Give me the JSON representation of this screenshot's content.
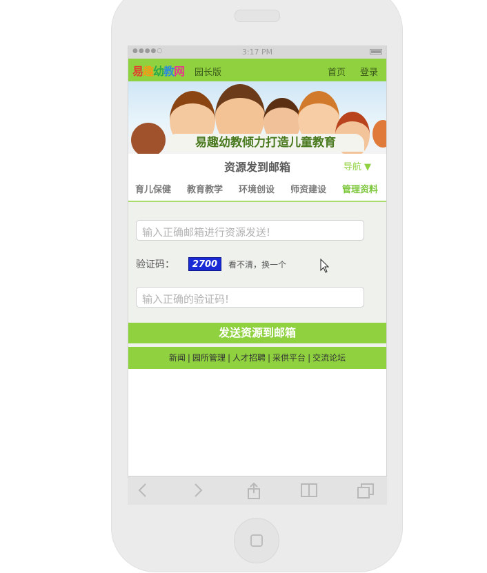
{
  "status_bar": {
    "signal": "●●●●○",
    "time": "3:17 PM"
  },
  "header": {
    "logo_chars": [
      "易",
      "趣",
      "幼",
      "教",
      "网"
    ],
    "version_label": "园长版",
    "nav": [
      {
        "label": "首页"
      },
      {
        "label": "登录"
      }
    ]
  },
  "banner": {
    "slogan": "易趣幼教倾力打造儿童教育"
  },
  "page": {
    "title": "资源发到邮箱",
    "nav_toggle": "导航 ▼"
  },
  "tabs": [
    {
      "label": "育儿保健",
      "active": false
    },
    {
      "label": "教育教学",
      "active": false
    },
    {
      "label": "环境创设",
      "active": false
    },
    {
      "label": "师资建设",
      "active": false
    },
    {
      "label": "管理资料",
      "active": true
    }
  ],
  "form": {
    "email_placeholder": "输入正确邮箱进行资源发送!",
    "captcha_label": "验证码：",
    "captcha_code": "2700",
    "captcha_refresh": "看不清，换一个",
    "captcha_placeholder": "输入正确的验证码!",
    "submit_label": "发送资源到邮箱"
  },
  "footer": {
    "links": [
      "新闻",
      "园所管理",
      "人才招聘",
      "采供平台",
      "交流论坛"
    ],
    "separator": "|"
  },
  "browser_toolbar": {
    "icons": [
      "back-icon",
      "forward-icon",
      "share-icon",
      "bookmarks-icon",
      "tabs-icon"
    ]
  },
  "colors": {
    "accent": "#8fd13f",
    "active_tab": "#7cc63a",
    "captcha_bg": "#1a2bd6"
  }
}
